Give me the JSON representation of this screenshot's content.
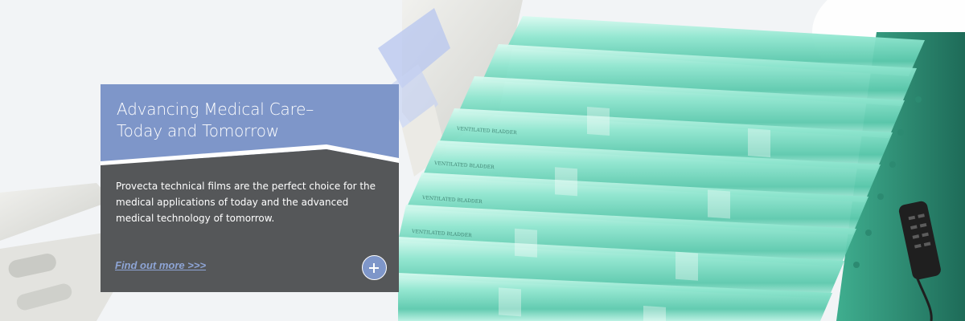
{
  "hero": {
    "title": "Advancing Medical Care–\nToday and Tomorrow",
    "body": "Provecta technical films are the perfect choice for the medical applications of today and the advanced medical technology of tomorrow.",
    "link_label": "Find out more >>>",
    "plus_icon": "plus-icon"
  },
  "bladder_label": "VENTILATED BLADDER",
  "colors": {
    "card_top": "#7e96c9",
    "card_bottom": "#555759",
    "accent_blue": "#8ea5d6",
    "mattress_teal": "#7fdcc4",
    "mattress_dark": "#2e7f6b"
  }
}
